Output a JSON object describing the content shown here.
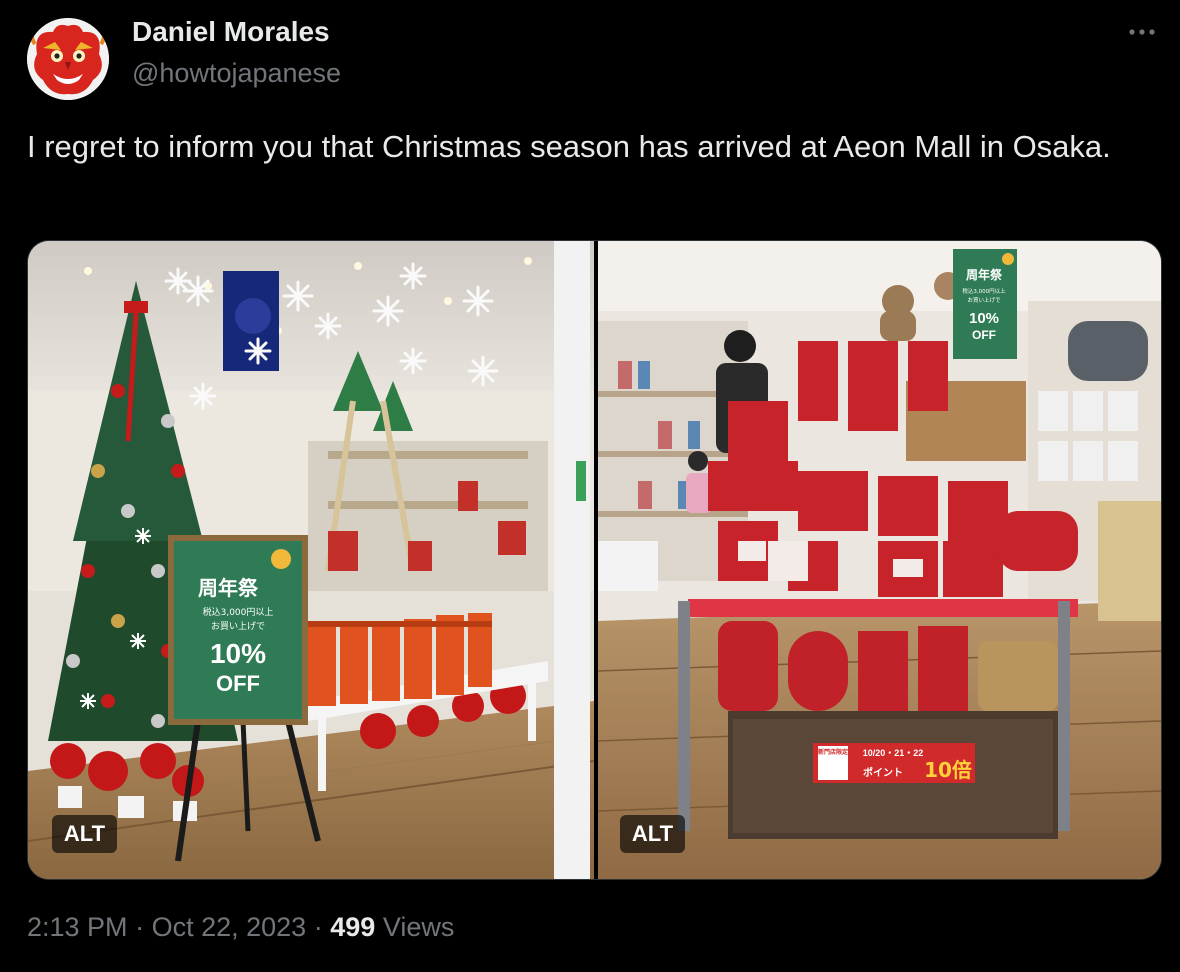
{
  "author": {
    "name": "Daniel Morales",
    "handle": "@howtojapanese",
    "avatar_icon": "red-dragon-mask-avatar"
  },
  "tweet": {
    "text": "I regret to inform you that Christmas season has arrived at Aeon Mall in Osaka."
  },
  "media": {
    "left": {
      "alt_label": "ALT",
      "sign": {
        "title": "周年祭",
        "line1": "税込3,000円以上",
        "line2": "お買い上げで",
        "discount": "10%",
        "off": "OFF"
      }
    },
    "right": {
      "alt_label": "ALT",
      "sign": {
        "title": "周年祭",
        "line1": "税込3,000円以上",
        "line2": "お買い上げで",
        "discount": "10%",
        "off": "OFF"
      },
      "banner": {
        "left_text": "新門店限定",
        "dates": "10/20・21・22",
        "sub": "ポイント",
        "multiplier": "10倍"
      }
    }
  },
  "meta": {
    "time": "2:13 PM",
    "separator": "·",
    "date": "Oct 22, 2023",
    "views_count": "499",
    "views_label": "Views"
  },
  "colors": {
    "background": "#000000",
    "text": "#e7e9ea",
    "secondary": "#71767b",
    "sign_green": "#2e7b55",
    "display_red": "#d12a2a"
  }
}
